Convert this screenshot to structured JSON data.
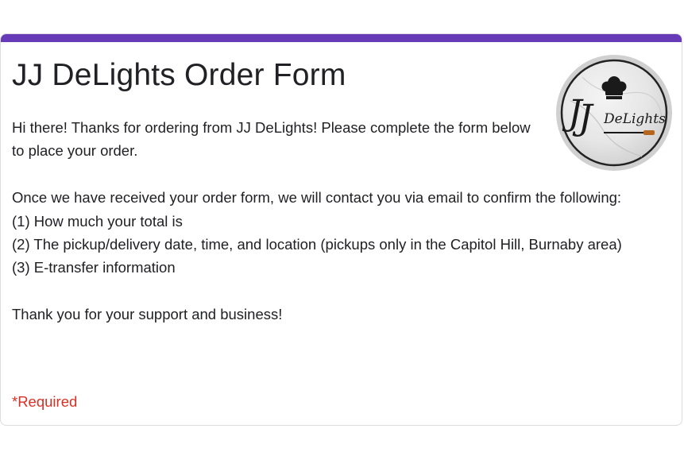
{
  "form": {
    "title": "JJ DeLights Order Form",
    "accent_color": "#673ab7",
    "description": {
      "intro": "Hi there! Thanks for ordering from JJ DeLights! Please complete the form below to place your order.",
      "confirm_intro": "Once we have received your order form, we will contact you via email to confirm the following:",
      "items": [
        "(1) How much your total is",
        "(2) The pickup/delivery date, time, and location (pickups only in the Capitol Hill, Burnaby area)",
        "(3) E-transfer information"
      ],
      "closing": "Thank you for your support and business!"
    },
    "required_note": "*Required",
    "required_color": "#d93025",
    "logo": {
      "text": "JJ DeLights",
      "icon": "chef-hat-icon"
    }
  }
}
